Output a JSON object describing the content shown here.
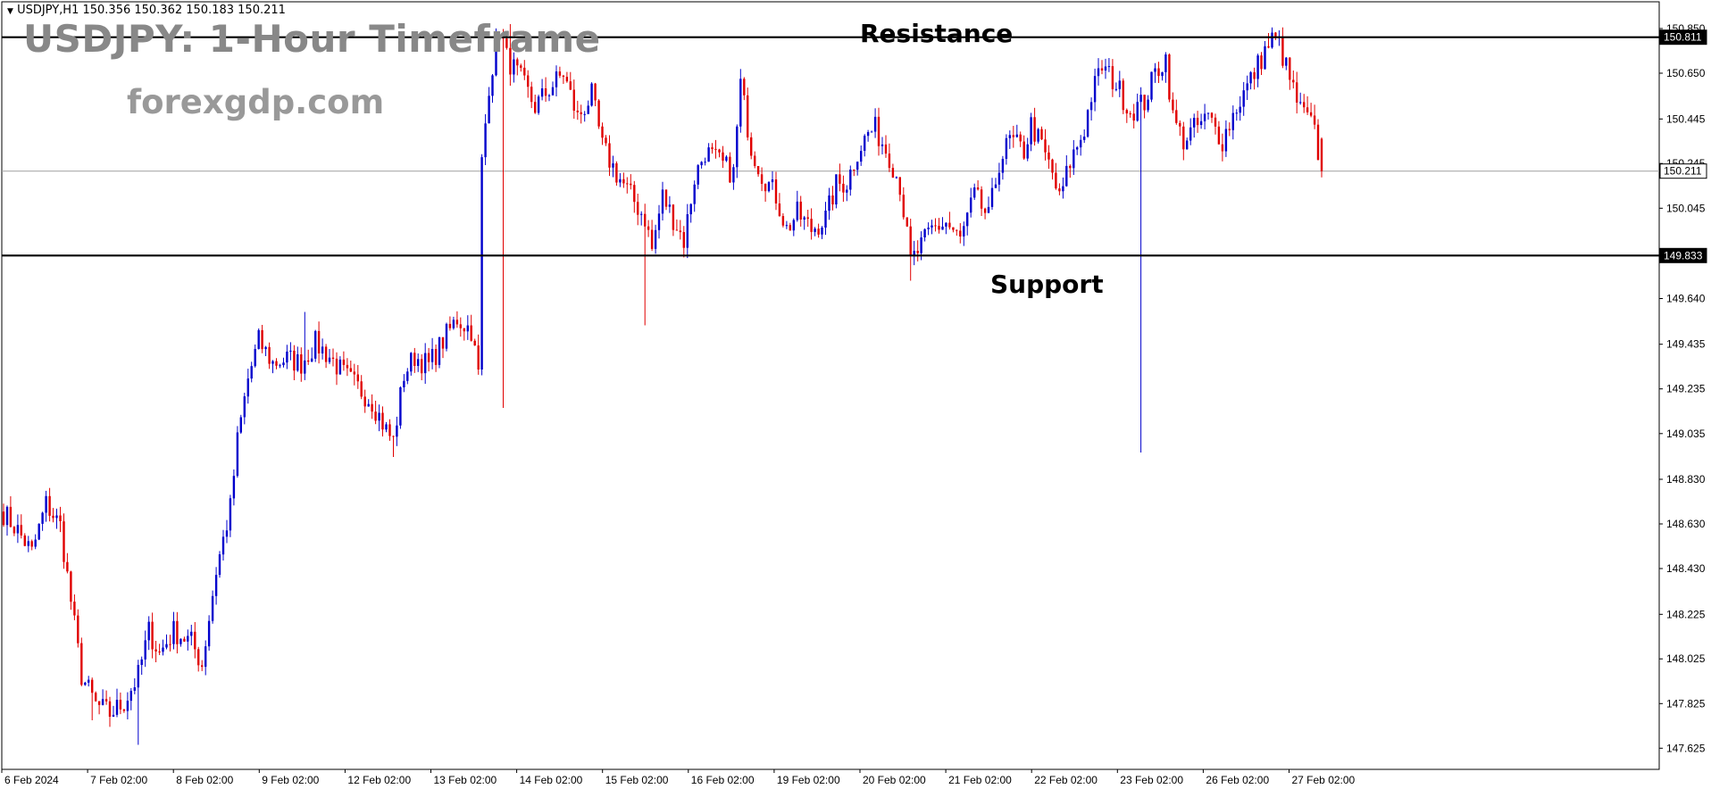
{
  "header": {
    "symbol_info": "USDJPY,H1  150.356 150.362 150.183 150.211",
    "title": "USDJPY: 1-Hour Timeframe",
    "watermark": "forexgdp.com"
  },
  "annotations": {
    "resistance_label": "Resistance",
    "support_label": "Support"
  },
  "colors": {
    "bull": "#0000cc",
    "bear": "#e00000",
    "level_line": "#000000",
    "price_line": "#a0a0a0",
    "background": "#ffffff"
  },
  "chart_data": {
    "type": "candlestick",
    "symbol": "USDJPY",
    "timeframe": "H1",
    "ohlc_header": {
      "open": 150.356,
      "high": 150.362,
      "low": 150.183,
      "close": 150.211
    },
    "ylim": [
      147.53,
      150.97
    ],
    "y_ticks": [
      "150.850",
      "150.650",
      "150.445",
      "150.245",
      "150.045",
      "149.640",
      "149.435",
      "149.235",
      "149.035",
      "148.830",
      "148.630",
      "148.430",
      "148.225",
      "148.025",
      "147.825",
      "147.625"
    ],
    "x_ticks": [
      "6 Feb 2024",
      "7 Feb 02:00",
      "8 Feb 02:00",
      "9 Feb 02:00",
      "12 Feb 02:00",
      "13 Feb 02:00",
      "14 Feb 02:00",
      "15 Feb 02:00",
      "16 Feb 02:00",
      "19 Feb 02:00",
      "20 Feb 02:00",
      "21 Feb 02:00",
      "22 Feb 02:00",
      "23 Feb 02:00",
      "26 Feb 02:00",
      "27 Feb 02:00"
    ],
    "levels": [
      {
        "name": "Resistance",
        "value": 150.811
      },
      {
        "name": "Support",
        "value": 149.833
      }
    ],
    "current_price": 150.211,
    "close_anchors": [
      [
        0,
        148.68
      ],
      [
        4,
        148.6
      ],
      [
        8,
        148.5
      ],
      [
        12,
        148.72
      ],
      [
        16,
        148.62
      ],
      [
        22,
        147.95
      ],
      [
        26,
        147.82
      ],
      [
        30,
        147.78
      ],
      [
        34,
        147.83
      ],
      [
        38,
        147.95
      ],
      [
        41,
        148.15
      ],
      [
        44,
        148.05
      ],
      [
        48,
        148.15
      ],
      [
        53,
        148.1
      ],
      [
        56,
        148.0
      ],
      [
        60,
        148.42
      ],
      [
        64,
        148.7
      ],
      [
        66,
        149.0
      ],
      [
        69,
        149.28
      ],
      [
        72,
        149.45
      ],
      [
        76,
        149.35
      ],
      [
        80,
        149.37
      ],
      [
        84,
        149.35
      ],
      [
        88,
        149.44
      ],
      [
        92,
        149.38
      ],
      [
        96,
        149.3
      ],
      [
        100,
        149.24
      ],
      [
        104,
        149.18
      ],
      [
        108,
        149.05
      ],
      [
        110,
        149.0
      ],
      [
        113,
        149.3
      ],
      [
        116,
        149.38
      ],
      [
        120,
        149.34
      ],
      [
        124,
        149.45
      ],
      [
        128,
        149.55
      ],
      [
        132,
        149.5
      ],
      [
        134,
        149.3
      ],
      [
        135,
        150.25
      ],
      [
        137,
        150.6
      ],
      [
        140,
        150.85
      ],
      [
        142,
        150.72
      ],
      [
        146,
        150.62
      ],
      [
        150,
        150.5
      ],
      [
        154,
        150.58
      ],
      [
        158,
        150.65
      ],
      [
        162,
        150.45
      ],
      [
        166,
        150.55
      ],
      [
        169,
        150.32
      ],
      [
        173,
        150.2
      ],
      [
        177,
        150.1
      ],
      [
        181,
        150.0
      ],
      [
        183,
        149.86
      ],
      [
        186,
        150.1
      ],
      [
        189,
        150.0
      ],
      [
        192,
        149.9
      ],
      [
        195,
        150.18
      ],
      [
        198,
        150.3
      ],
      [
        202,
        150.25
      ],
      [
        206,
        150.2
      ],
      [
        208,
        150.6
      ],
      [
        211,
        150.32
      ],
      [
        214,
        150.2
      ],
      [
        218,
        150.1
      ],
      [
        221,
        149.95
      ],
      [
        224,
        150.02
      ],
      [
        228,
        149.95
      ],
      [
        232,
        150.0
      ],
      [
        235,
        150.15
      ],
      [
        238,
        150.16
      ],
      [
        241,
        150.3
      ],
      [
        244,
        150.38
      ],
      [
        246,
        150.4
      ],
      [
        250,
        150.28
      ],
      [
        253,
        150.15
      ],
      [
        256,
        149.8
      ],
      [
        258,
        149.85
      ],
      [
        262,
        149.95
      ],
      [
        266,
        149.98
      ],
      [
        270,
        149.9
      ],
      [
        274,
        150.1
      ],
      [
        278,
        150.0
      ],
      [
        281,
        150.25
      ],
      [
        284,
        150.35
      ],
      [
        288,
        150.3
      ],
      [
        290,
        150.42
      ],
      [
        293,
        150.32
      ],
      [
        296,
        150.2
      ],
      [
        298,
        150.08
      ],
      [
        301,
        150.25
      ],
      [
        305,
        150.4
      ],
      [
        307,
        150.55
      ],
      [
        310,
        150.68
      ],
      [
        314,
        150.6
      ],
      [
        318,
        150.48
      ],
      [
        322,
        150.52
      ],
      [
        325,
        150.65
      ],
      [
        328,
        150.72
      ],
      [
        330,
        150.45
      ],
      [
        333,
        150.35
      ],
      [
        336,
        150.4
      ],
      [
        340,
        150.45
      ],
      [
        344,
        150.35
      ],
      [
        348,
        150.5
      ],
      [
        352,
        150.62
      ],
      [
        356,
        150.75
      ],
      [
        358,
        150.8
      ],
      [
        360,
        150.78
      ],
      [
        363,
        150.62
      ],
      [
        366,
        150.48
      ],
      [
        368,
        150.45
      ],
      [
        370,
        150.38
      ],
      [
        372,
        150.211
      ]
    ],
    "spike_lows": [
      [
        110,
        148.93
      ],
      [
        141,
        149.15
      ],
      [
        181,
        149.52
      ],
      [
        256,
        149.72
      ],
      [
        321,
        148.95
      ],
      [
        38,
        147.64
      ],
      [
        25,
        147.75
      ]
    ],
    "spike_highs": [
      [
        143,
        150.87
      ],
      [
        85,
        149.58
      ],
      [
        208,
        150.63
      ],
      [
        357,
        150.83
      ]
    ]
  }
}
